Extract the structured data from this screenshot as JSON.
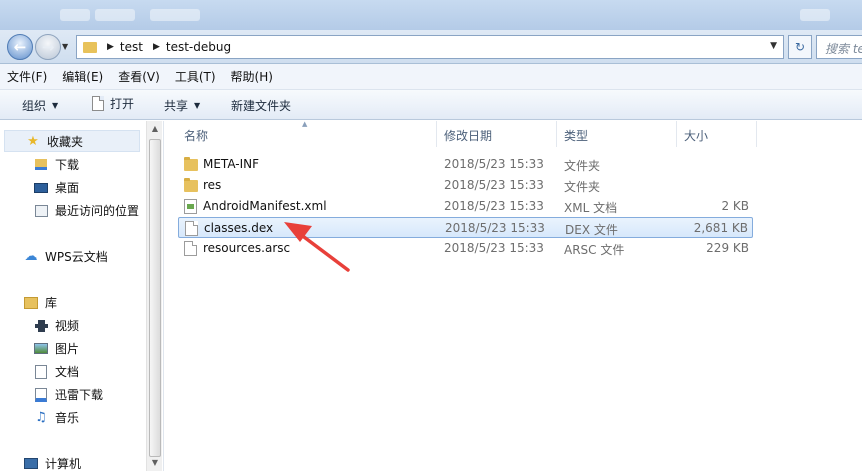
{
  "address": {
    "crumbs": [
      "test",
      "test-debug"
    ],
    "search_placeholder": "搜索 test"
  },
  "menu": [
    "文件(F)",
    "编辑(E)",
    "查看(V)",
    "工具(T)",
    "帮助(H)"
  ],
  "commands": {
    "organize": "组织",
    "open": "打开",
    "share": "共享",
    "new_folder": "新建文件夹"
  },
  "nav": {
    "favorites": "收藏夹",
    "downloads": "下载",
    "desktop": "桌面",
    "recent": "最近访问的位置",
    "wps": "WPS云文档",
    "library": "库",
    "videos": "视频",
    "pictures": "图片",
    "documents": "文档",
    "xunlei": "迅雷下载",
    "music": "音乐",
    "computer": "计算机"
  },
  "columns": {
    "name": "名称",
    "date": "修改日期",
    "type": "类型",
    "size": "大小"
  },
  "files": [
    {
      "name": "META-INF",
      "date": "2018/5/23 15:33",
      "type": "文件夹",
      "size": ""
    },
    {
      "name": "res",
      "date": "2018/5/23 15:33",
      "type": "文件夹",
      "size": ""
    },
    {
      "name": "AndroidManifest.xml",
      "date": "2018/5/23 15:33",
      "type": "XML 文档",
      "size": "2 KB"
    },
    {
      "name": "classes.dex",
      "date": "2018/5/23 15:33",
      "type": "DEX 文件",
      "size": "2,681 KB"
    },
    {
      "name": "resources.arsc",
      "date": "2018/5/23 15:33",
      "type": "ARSC 文件",
      "size": "229 KB"
    }
  ],
  "colors": {
    "annotation_arrow": "#e8403a",
    "selection_border": "#84acdd"
  }
}
